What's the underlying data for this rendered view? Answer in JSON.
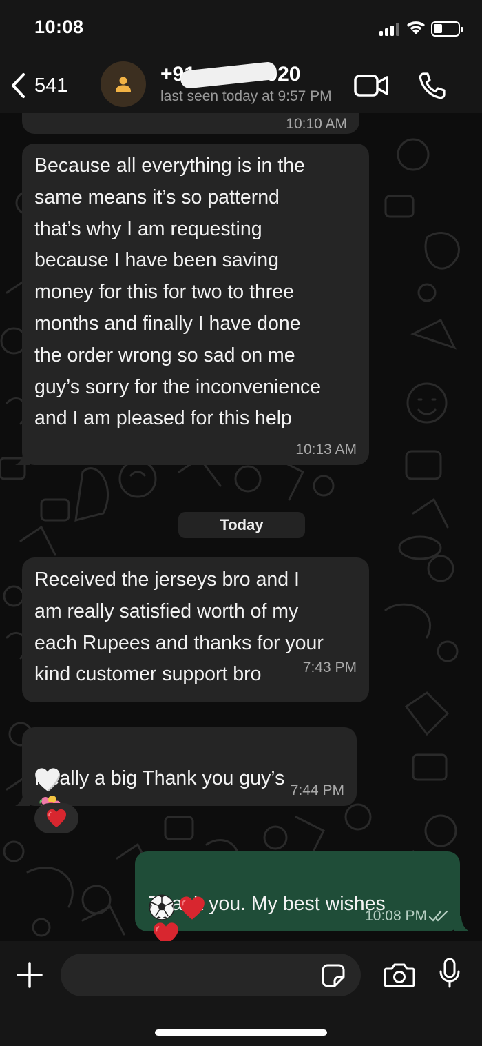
{
  "status_bar": {
    "time": "10:08",
    "icons": [
      "cellular-signal-icon",
      "wifi-icon",
      "battery-icon"
    ]
  },
  "header": {
    "back_count": "541",
    "contact_name": "+91 ••••• 36020",
    "contact_status": "last seen today at 9:57 PM",
    "icons": [
      "back-chevron-icon",
      "person-icon",
      "video-call-icon",
      "phone-icon"
    ]
  },
  "chat": {
    "first_time": "10:10 AM",
    "messages": [
      {
        "direction": "incoming",
        "text": "Because all everything is in the\nsame means it’s so patternd\nthat’s why I am requesting\nbecause I have been saving\nmoney for this for two to three\nmonths and finally I have done\nthe order wrong so sad on me\nguy’s sorry for the inconvenience\nand I am pleased for this help",
        "time": "10:13 AM"
      },
      {
        "direction": "incoming",
        "text": "Received the jerseys bro and I\nam really satisfied worth of my\neach Rupees and thanks for your\nkind customer support bro",
        "time": "7:43 PM"
      },
      {
        "direction": "incoming",
        "text": "Really a big Thank you guy’s",
        "emojis": [
          "bouquet",
          "white-heart"
        ],
        "time": "7:44 PM",
        "reaction": "red-heart"
      },
      {
        "direction": "outgoing",
        "text": "Thank you. My best wishes",
        "emojis": [
          "red-heart",
          "soccer-ball",
          "red-heart"
        ],
        "time": "10:08 PM",
        "read": true
      }
    ],
    "date_divider": "Today"
  },
  "input_bar": {
    "placeholder": "",
    "icons": [
      "plus-icon",
      "sticker-icon",
      "camera-icon",
      "microphone-icon"
    ]
  },
  "colors": {
    "incoming_bubble": "#252525",
    "outgoing_bubble": "#1f4d38",
    "background": "#0d0d0d",
    "bars": "#161616"
  }
}
